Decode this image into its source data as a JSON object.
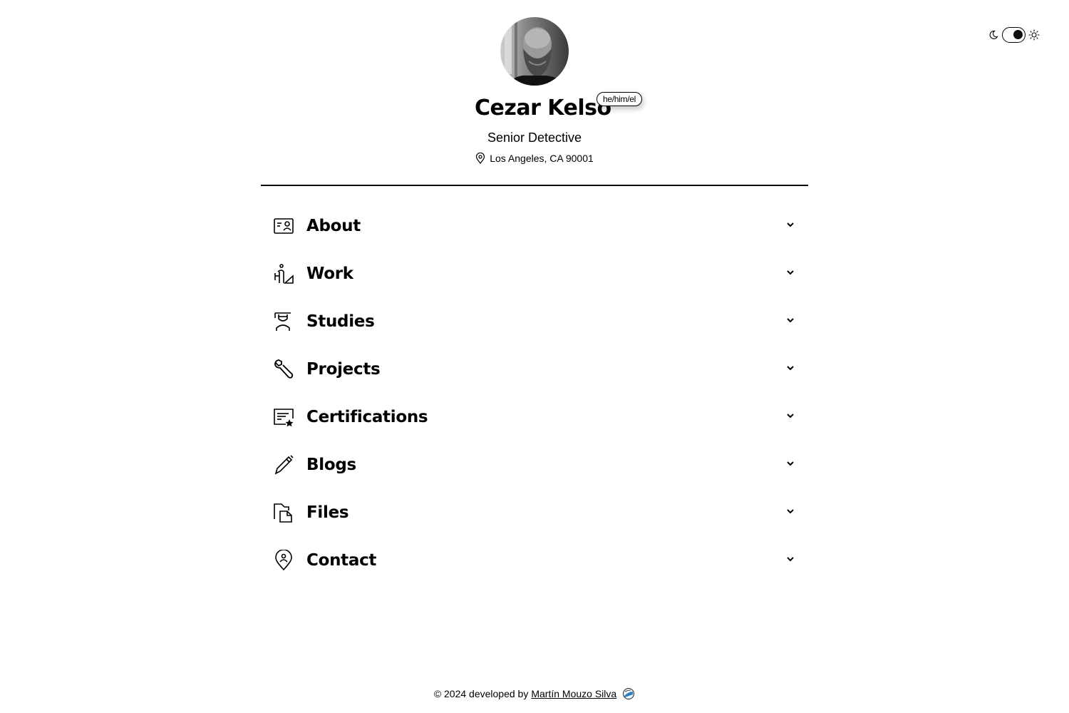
{
  "profile": {
    "name": "Cezar Kelso",
    "pronouns": "he/him/el",
    "role": "Senior Detective",
    "location": "Los Angeles, CA 90001"
  },
  "sections": [
    {
      "label": "About",
      "icon": "id-card-icon"
    },
    {
      "label": "Work",
      "icon": "worker-icon"
    },
    {
      "label": "Studies",
      "icon": "graduate-icon"
    },
    {
      "label": "Projects",
      "icon": "wrench-icon"
    },
    {
      "label": "Certifications",
      "icon": "certificate-icon"
    },
    {
      "label": "Blogs",
      "icon": "pencil-icon"
    },
    {
      "label": "Files",
      "icon": "files-icon"
    },
    {
      "label": "Contact",
      "icon": "map-pin-user-icon"
    }
  ],
  "footer": {
    "prefix": "© 2024 developed by",
    "author": "Martín Mouzo Silva"
  },
  "theme": {
    "mode": "dark-selected"
  }
}
